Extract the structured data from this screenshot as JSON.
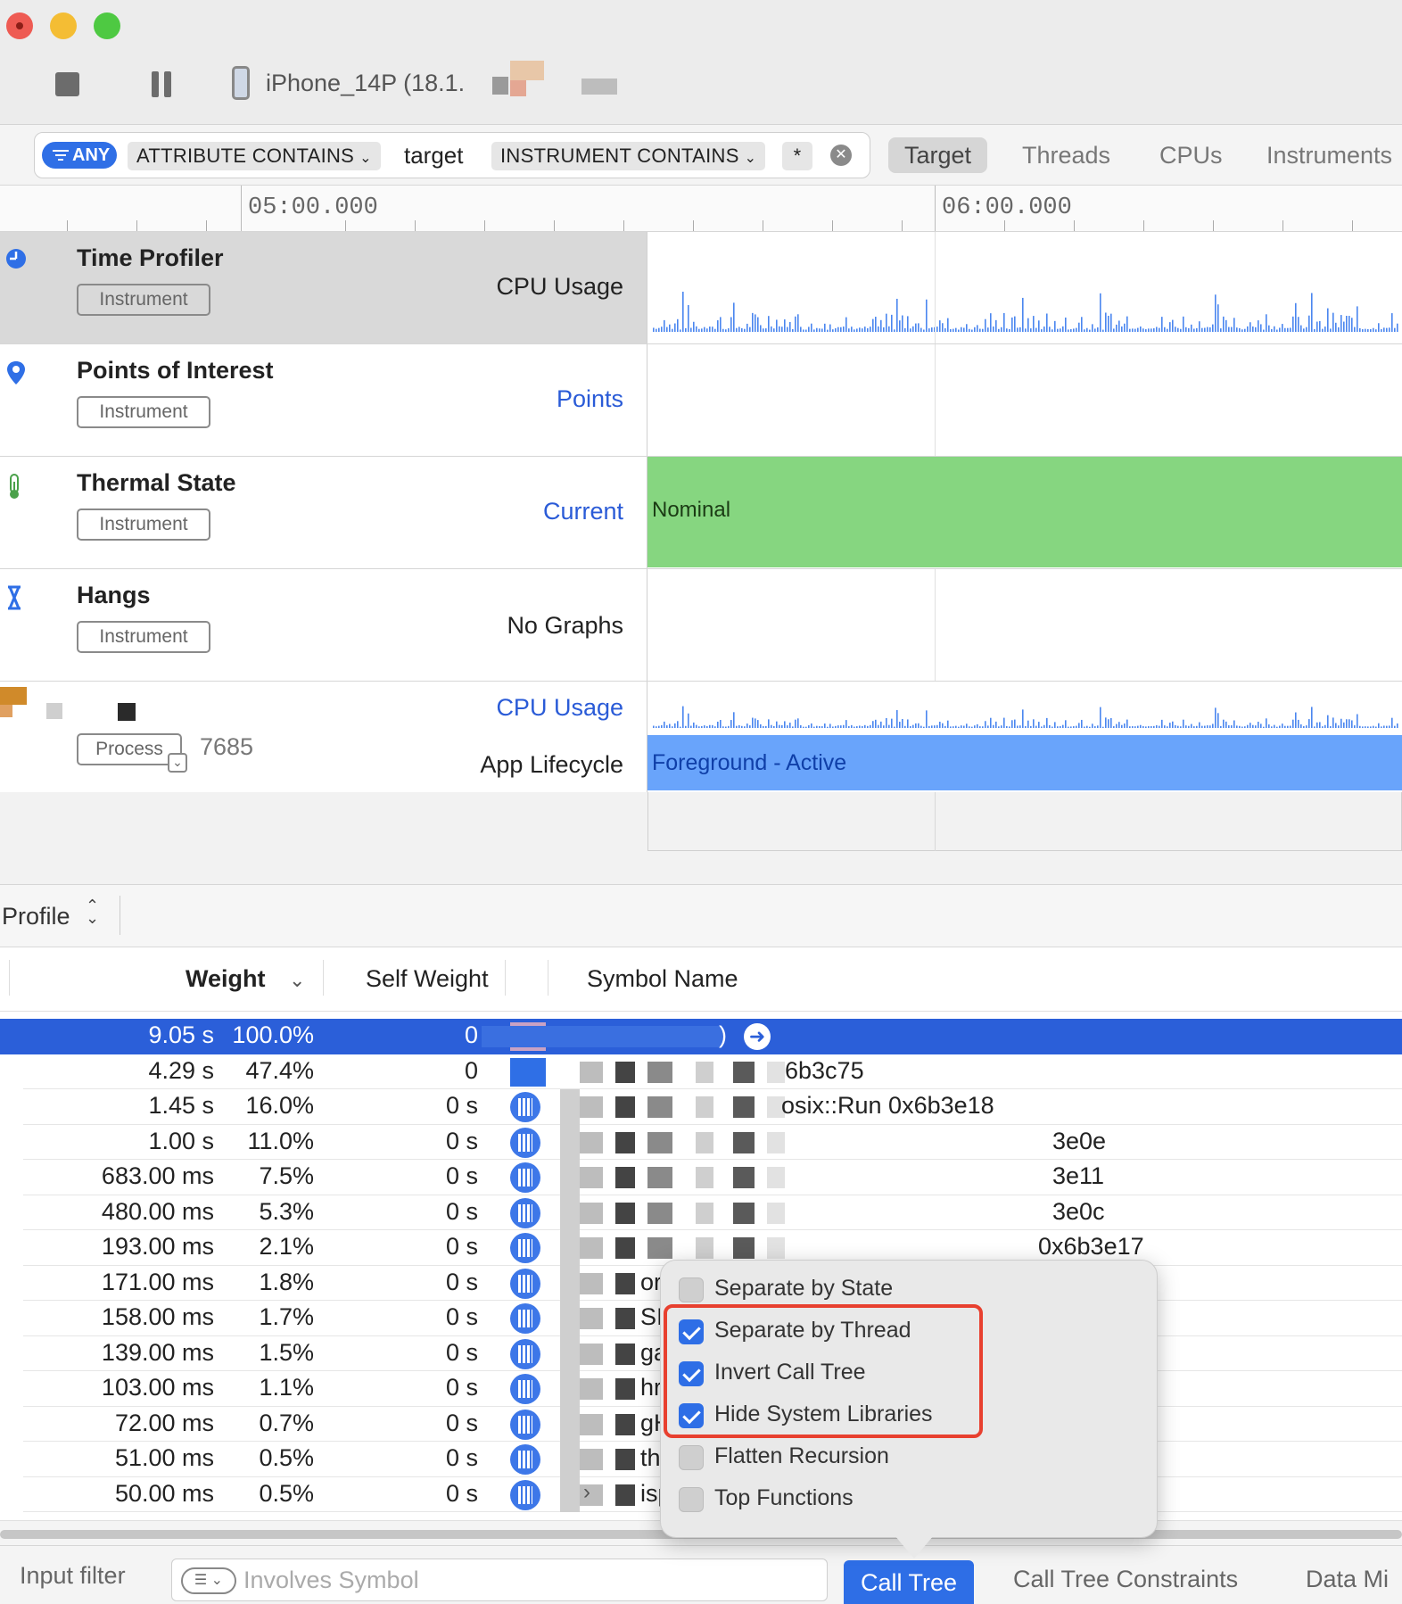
{
  "toolbar": {
    "device_name": "iPhone_14P (18.1."
  },
  "filter": {
    "any_label": "ANY",
    "token1": "ATTRIBUTE CONTAINS",
    "token1_value": "target",
    "token2": "INSTRUMENT CONTAINS",
    "token2_value": "*",
    "tabs": [
      "Target",
      "Threads",
      "CPUs",
      "Instruments"
    ],
    "active_tab": "Target"
  },
  "ruler": {
    "labels": [
      "05:00.000",
      "06:00.000"
    ]
  },
  "tracks": [
    {
      "name": "Time Profiler",
      "badge": "Instrument",
      "graph": "CPU Usage",
      "graph_style": "black",
      "icon": "clock-icon",
      "selected": true
    },
    {
      "name": "Points of Interest",
      "badge": "Instrument",
      "graph": "Points",
      "graph_style": "blue",
      "icon": "location-pin-icon"
    },
    {
      "name": "Thermal State",
      "badge": "Instrument",
      "graph": "Current",
      "graph_style": "blue",
      "icon": "thermometer-icon",
      "band_text": "Nominal"
    },
    {
      "name": "Hangs",
      "badge": "Instrument",
      "graph": "No Graphs",
      "graph_style": "black",
      "icon": "hourglass-icon"
    },
    {
      "badge": "Process",
      "pid": "7685",
      "graph": "CPU Usage",
      "graph2": "App Lifecycle",
      "band_text": "Foreground - Active"
    }
  ],
  "colors": {
    "accent": "#2b5fd9",
    "thermal_nominal": "#86d680",
    "foreground_active": "#69a4fb",
    "highlight": "#e8402f"
  },
  "detail": {
    "mode": "Profile",
    "columns": [
      "Weight",
      "Self Weight",
      "Symbol Name"
    ]
  },
  "rows": [
    {
      "weight": "9.05 s",
      "pct": "100.0%",
      "self": "0",
      "symbol": ")",
      "selected": true
    },
    {
      "weight": "4.29 s",
      "pct": "47.4%",
      "self": "0",
      "symbol": "6b3c75"
    },
    {
      "weight": "1.45 s",
      "pct": "16.0%",
      "self": "0 s",
      "symbol": "osix::Run  0x6b3e18"
    },
    {
      "weight": "1.00 s",
      "pct": "11.0%",
      "self": "0 s",
      "symbol": "3e0e"
    },
    {
      "weight": "683.00 ms",
      "pct": "7.5%",
      "self": "0 s",
      "symbol": "3e11"
    },
    {
      "weight": "480.00 ms",
      "pct": "5.3%",
      "self": "0 s",
      "symbol": "3e0c"
    },
    {
      "weight": "193.00 ms",
      "pct": "2.1%",
      "self": "0 s",
      "symbol": "0x6b3e17"
    },
    {
      "weight": "171.00 ms",
      "pct": "1.8%",
      "self": "0 s",
      "symbol": "or"
    },
    {
      "weight": "158.00 ms",
      "pct": "1.7%",
      "self": "0 s",
      "symbol": "SI"
    },
    {
      "weight": "139.00 ms",
      "pct": "1.5%",
      "self": "0 s",
      "symbol": "ga"
    },
    {
      "weight": "103.00 ms",
      "pct": "1.1%",
      "self": "0 s",
      "symbol": "hr"
    },
    {
      "weight": "72.00 ms",
      "pct": "0.7%",
      "self": "0 s",
      "symbol": "gH"
    },
    {
      "weight": "51.00 ms",
      "pct": "0.5%",
      "self": "0 s",
      "symbol": "thr"
    },
    {
      "weight": "50.00 ms",
      "pct": "0.5%",
      "self": "0 s",
      "symbol": "isp"
    }
  ],
  "popover": {
    "options": [
      {
        "label": "Separate by State",
        "checked": false
      },
      {
        "label": "Separate by Thread",
        "checked": true
      },
      {
        "label": "Invert Call Tree",
        "checked": true
      },
      {
        "label": "Hide System Libraries",
        "checked": true
      },
      {
        "label": "Flatten Recursion",
        "checked": false
      },
      {
        "label": "Top Functions",
        "checked": false
      }
    ]
  },
  "bottom": {
    "input_filter_label": "Input filter",
    "search_placeholder": "Involves Symbol",
    "tabs": [
      "Call Tree",
      "Call Tree Constraints",
      "Data Mi"
    ]
  }
}
